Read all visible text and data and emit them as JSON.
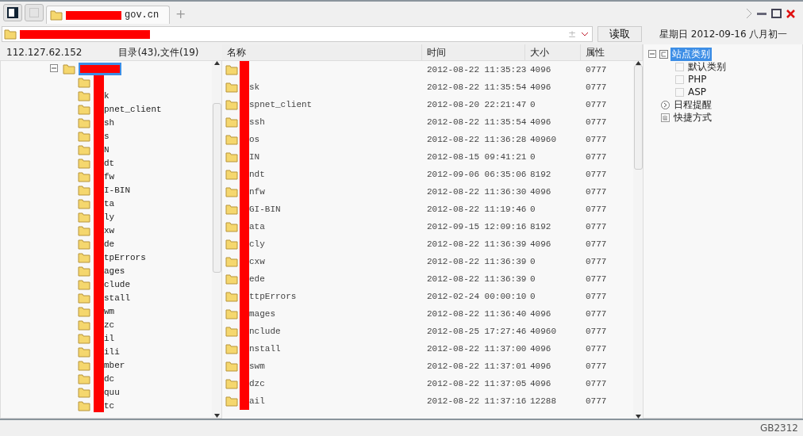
{
  "tabs": [
    {
      "label": "gov.cn",
      "redacted": true,
      "selected": true
    }
  ],
  "new_tab": "+",
  "address": {
    "redacted": true,
    "symbol": "±",
    "button": "读取"
  },
  "date_line": "星期日 2012-09-16 八月初一",
  "left_pane": {
    "ip": "112.127.62.152",
    "summary": "目录(43),文件(19)",
    "tree": {
      "redacted": true,
      "expanded": true,
      "selected": true,
      "children": [
        {
          "redacted": true
        },
        {
          "label": "k",
          "redacted": true
        },
        {
          "label": "pnet_client",
          "redacted": true
        },
        {
          "label": "sh",
          "redacted": true
        },
        {
          "label": "s",
          "redacted": true
        },
        {
          "label": "N",
          "redacted": true
        },
        {
          "label": "dt",
          "redacted": true
        },
        {
          "label": "fw",
          "redacted": true
        },
        {
          "label": "I-BIN",
          "redacted": true
        },
        {
          "label": "ta",
          "redacted": true
        },
        {
          "label": "ly",
          "redacted": true
        },
        {
          "label": "xw",
          "redacted": true
        },
        {
          "label": "de",
          "redacted": true
        },
        {
          "label": "tpErrors",
          "redacted": true
        },
        {
          "label": "ages",
          "redacted": true
        },
        {
          "label": "clude",
          "redacted": true
        },
        {
          "label": "stall",
          "redacted": true
        },
        {
          "label": "wm",
          "redacted": true
        },
        {
          "label": "zc",
          "redacted": true
        },
        {
          "label": "il",
          "redacted": true
        },
        {
          "label": "ili",
          "redacted": true
        },
        {
          "label": "mber",
          "redacted": true
        },
        {
          "label": "dc",
          "redacted": true
        },
        {
          "label": "quu",
          "redacted": true
        },
        {
          "label": "tc",
          "redacted": true
        }
      ]
    }
  },
  "file_list": {
    "columns": [
      "名称",
      "时间",
      "大小",
      "属性"
    ],
    "rows": [
      {
        "name": "",
        "time": "2012-08-22 11:35:23",
        "size": "4096",
        "attr": "0777"
      },
      {
        "name": "sk",
        "time": "2012-08-22 11:35:54",
        "size": "4096",
        "attr": "0777"
      },
      {
        "name": "spnet_client",
        "time": "2012-08-20 22:21:47",
        "size": "0",
        "attr": "0777"
      },
      {
        "name": "ssh",
        "time": "2012-08-22 11:35:54",
        "size": "4096",
        "attr": "0777"
      },
      {
        "name": "os",
        "time": "2012-08-22 11:36:28",
        "size": "40960",
        "attr": "0777"
      },
      {
        "name": "IN",
        "time": "2012-08-15 09:41:21",
        "size": "0",
        "attr": "0777"
      },
      {
        "name": "ndt",
        "time": "2012-09-06 06:35:06",
        "size": "8192",
        "attr": "0777"
      },
      {
        "name": "nfw",
        "time": "2012-08-22 11:36:30",
        "size": "4096",
        "attr": "0777"
      },
      {
        "name": "GI-BIN",
        "time": "2012-08-22 11:19:46",
        "size": "0",
        "attr": "0777"
      },
      {
        "name": "ata",
        "time": "2012-09-15 12:09:16",
        "size": "8192",
        "attr": "0777"
      },
      {
        "name": "cly",
        "time": "2012-08-22 11:36:39",
        "size": "4096",
        "attr": "0777"
      },
      {
        "name": "cxw",
        "time": "2012-08-22 11:36:39",
        "size": "0",
        "attr": "0777"
      },
      {
        "name": "ede",
        "time": "2012-08-22 11:36:39",
        "size": "0",
        "attr": "0777"
      },
      {
        "name": "ttpErrors",
        "time": "2012-02-24 00:00:10",
        "size": "0",
        "attr": "0777"
      },
      {
        "name": "mages",
        "time": "2012-08-22 11:36:40",
        "size": "4096",
        "attr": "0777"
      },
      {
        "name": "nclude",
        "time": "2012-08-25 17:27:46",
        "size": "40960",
        "attr": "0777"
      },
      {
        "name": "nstall",
        "time": "2012-08-22 11:37:00",
        "size": "4096",
        "attr": "0777"
      },
      {
        "name": "swm",
        "time": "2012-08-22 11:37:01",
        "size": "4096",
        "attr": "0777"
      },
      {
        "name": "dzc",
        "time": "2012-08-22 11:37:05",
        "size": "4096",
        "attr": "0777"
      },
      {
        "name": "ail",
        "time": "2012-08-22 11:37:16",
        "size": "12288",
        "attr": "0777"
      }
    ]
  },
  "side_tree": [
    {
      "label": "站点类别",
      "kind": "category",
      "expanded": true,
      "selected": true,
      "children": [
        {
          "label": "默认类别",
          "selected": false
        },
        {
          "label": "PHP",
          "selected": false
        },
        {
          "label": "ASP",
          "selected": false
        }
      ]
    },
    {
      "label": "日程提醒",
      "kind": "schedule",
      "selected": false
    },
    {
      "label": "快捷方式",
      "kind": "shortcut",
      "selected": false
    }
  ],
  "status_bar": {
    "encoding": "GB2312"
  }
}
